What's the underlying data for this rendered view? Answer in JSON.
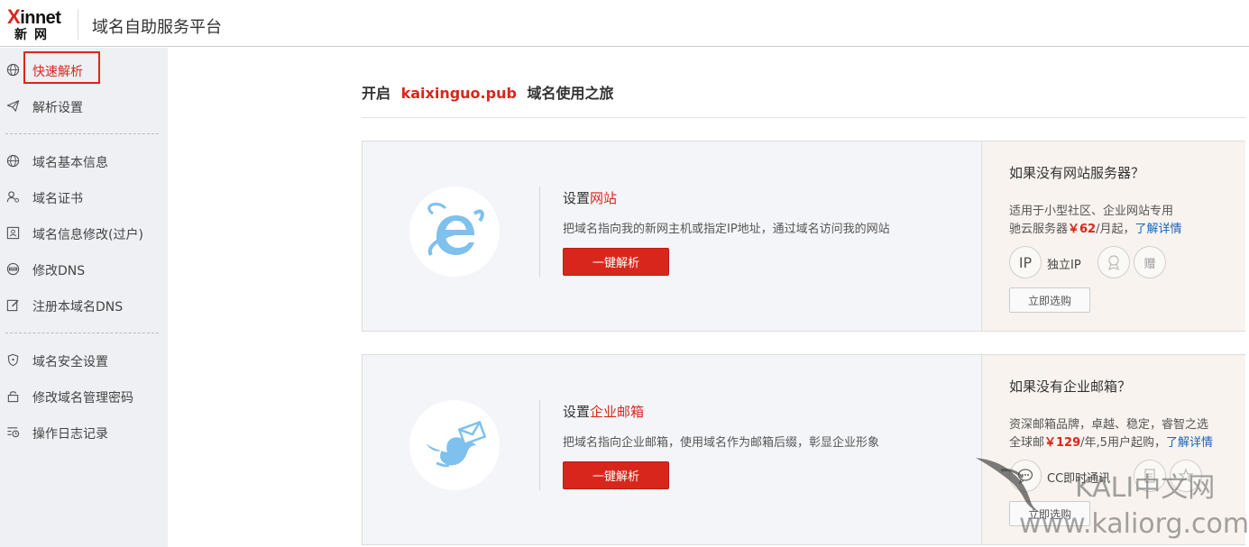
{
  "header": {
    "logo_top": "innet",
    "logo_x": "X",
    "logo_bottom": "新网",
    "title": "域名自助服务平台"
  },
  "sidebar": {
    "items": [
      {
        "label": "快速解析",
        "icon": "globe-icon"
      },
      {
        "label": "解析设置",
        "icon": "paper-plane-icon"
      },
      {
        "label": "域名基本信息",
        "icon": "globe-icon"
      },
      {
        "label": "域名证书",
        "icon": "user-certificate-icon"
      },
      {
        "label": "域名信息修改(过户)",
        "icon": "id-card-icon"
      },
      {
        "label": "修改DNS",
        "icon": "dns-icon"
      },
      {
        "label": "注册本域名DNS",
        "icon": "edit-icon"
      },
      {
        "label": "域名安全设置",
        "icon": "shield-icon"
      },
      {
        "label": "修改域名管理密码",
        "icon": "lock-icon"
      },
      {
        "label": "操作日志记录",
        "icon": "log-list-icon"
      }
    ],
    "active_index": 0
  },
  "main": {
    "title_prefix": "开启",
    "domain": "kaixinguo.pub",
    "title_suffix": "域名使用之旅",
    "cards": [
      {
        "title_prefix": "设置",
        "title_highlight": "网站",
        "description": "把域名指向我的新网主机或指定IP地址，通过域名访问我的网站",
        "button": "一键解析",
        "icon": "ie-browser-icon",
        "side": {
          "title": "如果没有网站服务器？",
          "line1": "适用于小型社区、企业网站专用",
          "line2_prefix": "驰云服务器",
          "price": "￥62",
          "line2_suffix": "/月起，",
          "link": "了解详情",
          "badge_main": "IP",
          "badge_label": "独立IP",
          "badge2": "award-icon",
          "badge3": "赠",
          "button": "立即选购"
        }
      },
      {
        "title_prefix": "设置",
        "title_highlight": "企业邮箱",
        "description": "把域名指向企业邮箱，使用域名作为邮箱后缀，彰显企业形象",
        "button": "一键解析",
        "icon": "bird-mail-icon",
        "side": {
          "title": "如果没有企业邮箱？",
          "line1": "资深邮箱品牌，卓越、稳定，睿智之选",
          "line2_prefix": "全球邮",
          "price": "￥129",
          "line2_suffix": "/年,5用户起购，",
          "link": "了解详情",
          "badge_main": "chat-icon",
          "badge_label": "CC即时通讯",
          "badge2": "file-icon",
          "badge3": "star-icon",
          "button": "立即选购"
        }
      }
    ]
  },
  "watermark": {
    "line1": "KALI中文网",
    "line2": "www.kaliorg.com"
  },
  "colors": {
    "accent": "#d9261c",
    "link": "#1a63b8",
    "sidebar_bg": "#eef0f4",
    "card_bg": "#f4f5f9",
    "side_bg": "#f8f3ee",
    "icon_blue": "#7ec0ee"
  }
}
